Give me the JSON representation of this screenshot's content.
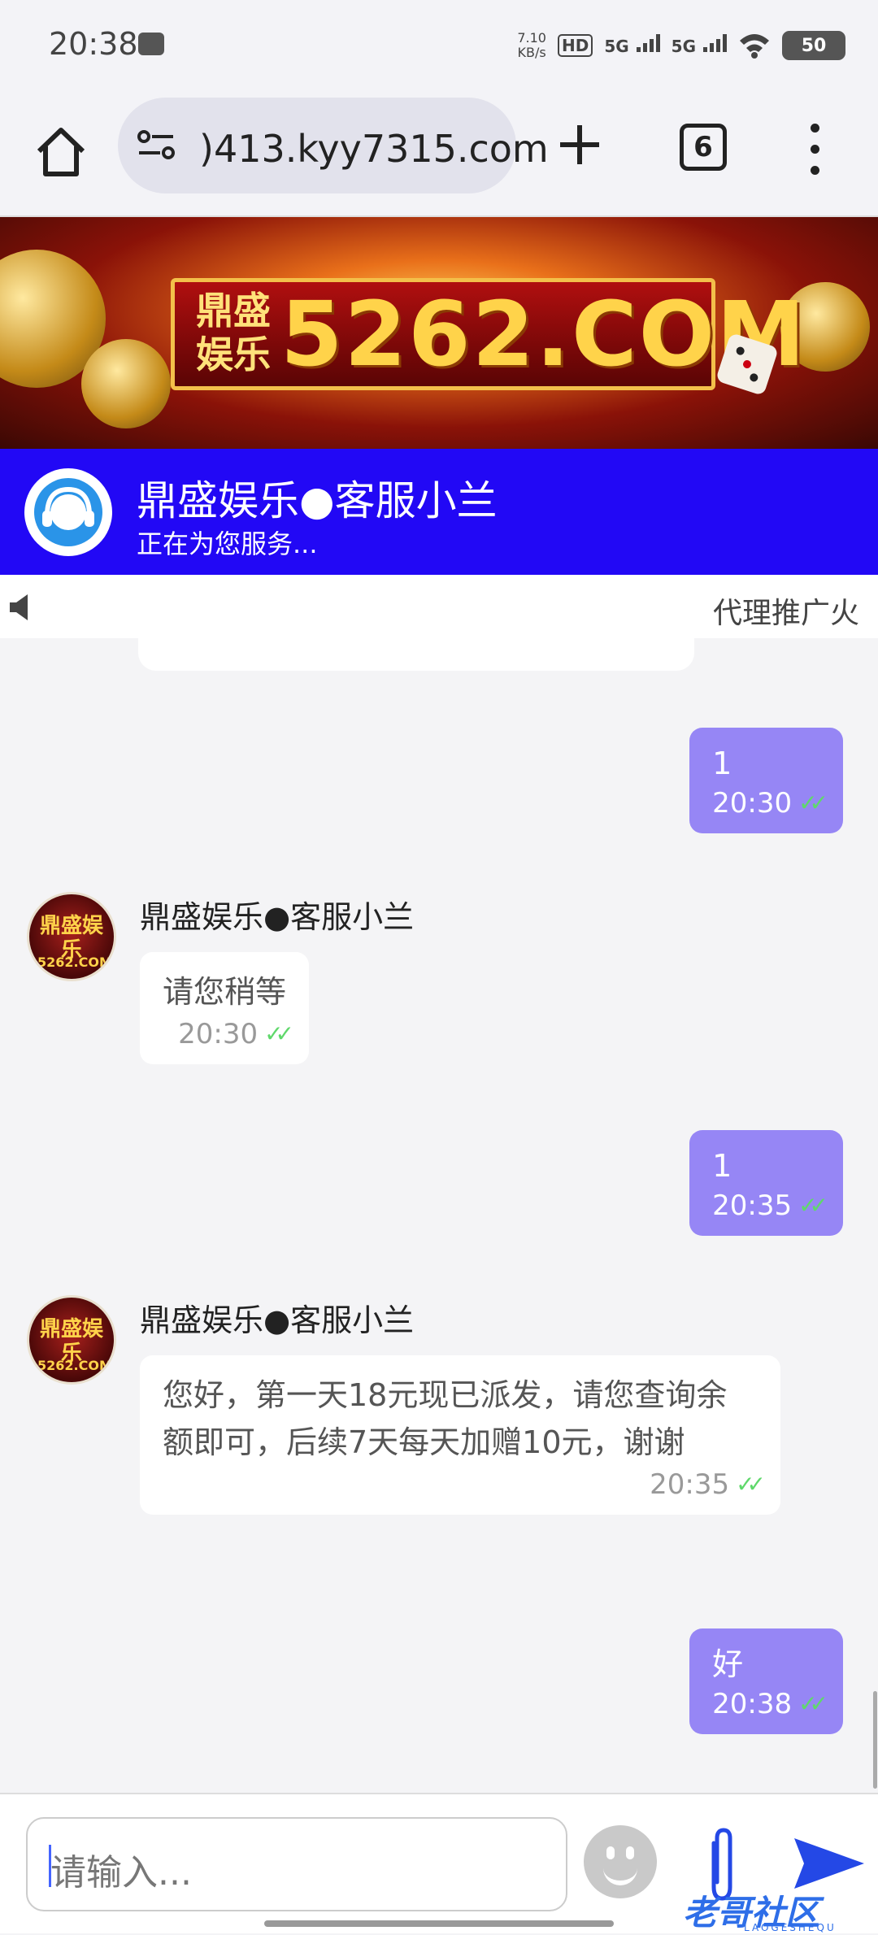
{
  "status_bar": {
    "time": "20:38",
    "net_speed_value": "7.10",
    "net_speed_unit": "KB/s",
    "hd_label": "HD",
    "signal_1": "5G",
    "signal_2": "5G",
    "battery": "50",
    "icons": [
      "camera-icon",
      "wifi-icon",
      "battery-icon"
    ]
  },
  "browser": {
    "url": ")413.kyy7315.com",
    "tab_count": "6",
    "icons": [
      "home-icon",
      "site-settings-icon",
      "new-tab-plus-icon",
      "tab-switcher-icon",
      "menu-icon"
    ]
  },
  "banner": {
    "brand_line1": "鼎盛",
    "brand_line2": "娱乐",
    "domain": "5262.COM"
  },
  "service_header": {
    "name": "鼎盛娱乐●客服小兰",
    "status": "正在为您服务..."
  },
  "marquee": {
    "text": "代理推广火"
  },
  "chat": {
    "messages": [
      {
        "dir": "out",
        "text": "1",
        "time": "20:30"
      },
      {
        "dir": "in",
        "sender": "鼎盛娱乐●客服小兰",
        "text": "请您稍等",
        "time": "20:30"
      },
      {
        "dir": "out",
        "text": "1",
        "time": "20:35"
      },
      {
        "dir": "in",
        "sender": "鼎盛娱乐●客服小兰",
        "text": "您好，第一天18元现已派发，请您查询余额即可，后续7天每天加赠10元，谢谢",
        "time": "20:35"
      },
      {
        "dir": "out",
        "text": "好",
        "time": "20:38"
      }
    ],
    "avatar_text": "鼎盛娱乐",
    "avatar_sub": "5262.COM"
  },
  "input_bar": {
    "placeholder": "请输入...",
    "watermark": "老哥社区",
    "watermark_sub": "LAOGESHEQU",
    "icons": [
      "emoji-icon",
      "attachment-icon",
      "send-icon"
    ]
  },
  "colors": {
    "header_bg": "#2208f5",
    "outgoing_bubble": "#9686f5",
    "check_color": "#5fd86b"
  }
}
